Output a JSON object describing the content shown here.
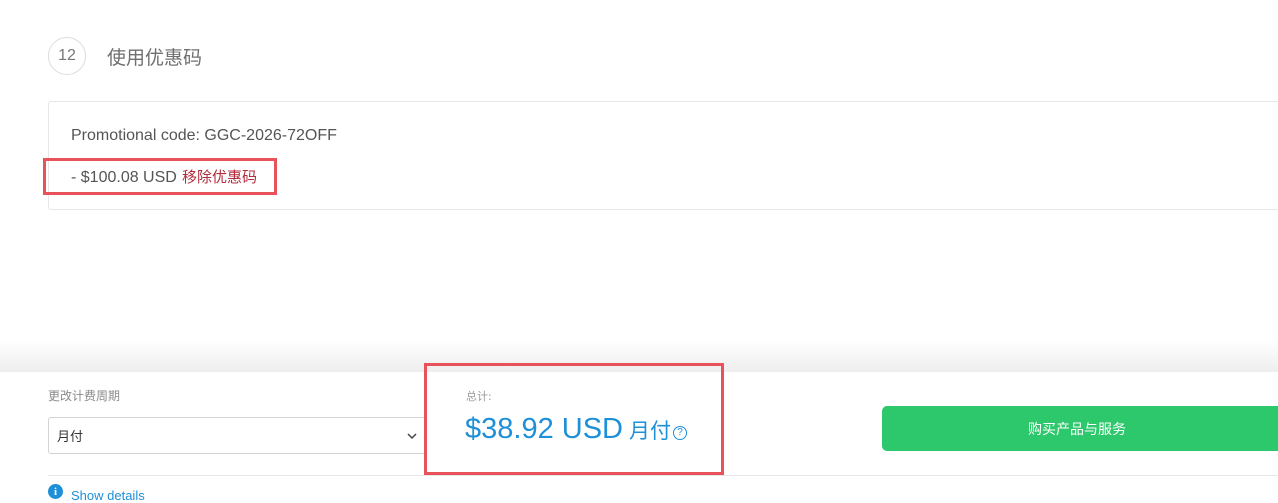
{
  "step": {
    "number": "12",
    "title": "使用优惠码"
  },
  "promo": {
    "code_line": "Promotional code: GGC-2026-72OFF",
    "discount_amount": "- $100.08 USD",
    "remove_label": "移除优惠码"
  },
  "billing": {
    "cycle_label": "更改计费周期",
    "cycle_value": "月付",
    "total_label": "总计:",
    "total_amount": "$38.92 USD",
    "total_period": "月付",
    "help_glyph": "?"
  },
  "actions": {
    "buy_label": "购买产品与服务",
    "show_details": "Show details"
  },
  "colors": {
    "accent_blue": "#1e90d8",
    "buy_green": "#2dc86b",
    "remove_red": "#b12c3c",
    "highlight_red": "#e8525a"
  }
}
